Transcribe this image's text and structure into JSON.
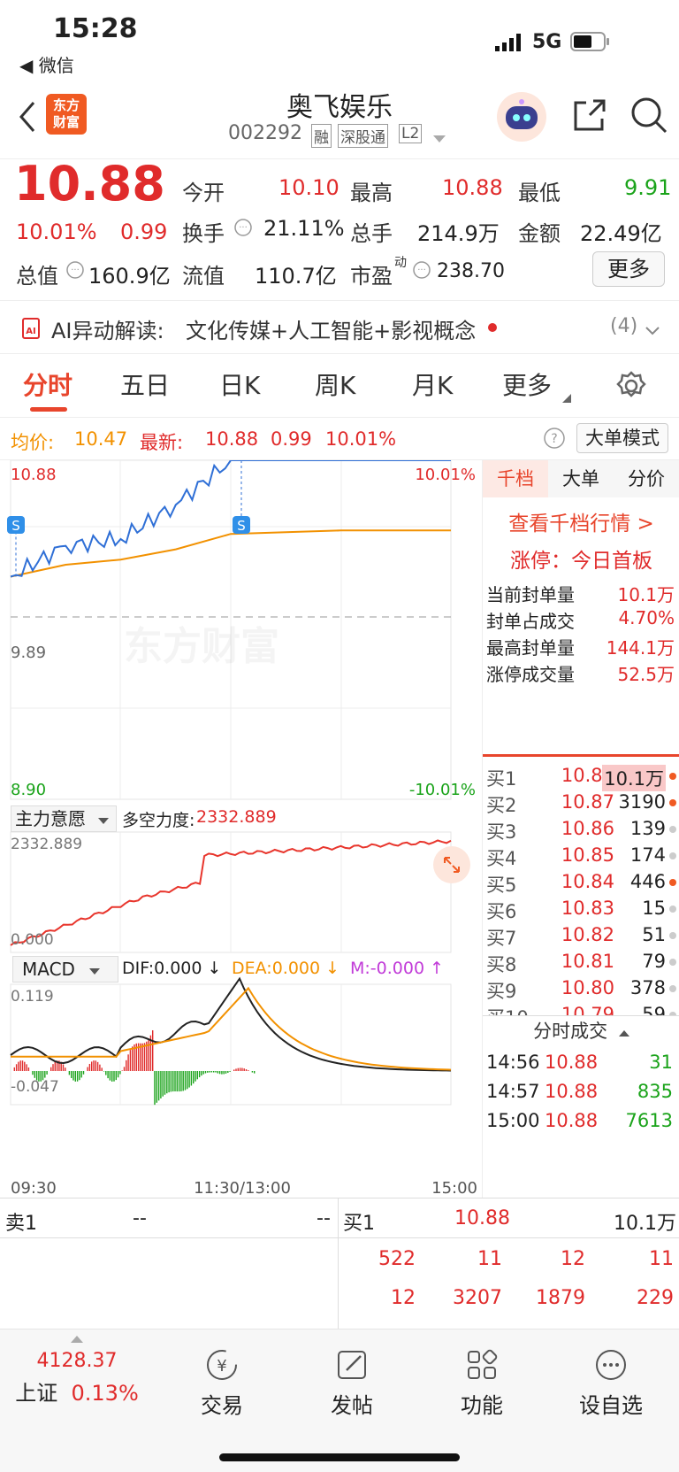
{
  "status_bar": {
    "time": "15:28",
    "back_app": "◀ 微信",
    "network": "5G"
  },
  "header": {
    "title": "奥飞娱乐",
    "code": "002292",
    "tags": [
      "融",
      "深股通",
      "L2"
    ],
    "logo_line1": "东方",
    "logo_line2": "财富"
  },
  "quote": {
    "price": "10.88",
    "change_pct": "10.01%",
    "change": "0.99",
    "fields": [
      {
        "label": "今开",
        "value": "10.10"
      },
      {
        "label": "最高",
        "value": "10.88"
      },
      {
        "label": "最低",
        "value": "9.91"
      },
      {
        "label": "换手",
        "value": "21.11%"
      },
      {
        "label": "总手",
        "value": "214.9万"
      },
      {
        "label": "金额",
        "value": "22.49亿"
      },
      {
        "label": "总值",
        "value": "160.9亿"
      },
      {
        "label": "流值",
        "value": "110.7亿"
      },
      {
        "label": "市盈",
        "value": "238.70"
      }
    ],
    "pe_sup": "动",
    "more_label": "更多"
  },
  "ai_bar": {
    "prefix": "AI异动解读:",
    "text": "文化传媒+人工智能+影视概念",
    "count": "(4)"
  },
  "tabs": [
    "分时",
    "五日",
    "日K",
    "周K",
    "月K",
    "更多"
  ],
  "info_bar": {
    "avg_label": "均价:",
    "avg": "10.47",
    "latest_label": "最新:",
    "latest": "10.88",
    "chg": "0.99",
    "pct": "10.01%",
    "mode_label": "大单模式"
  },
  "chart": {
    "y_top": "10.88",
    "y_mid": "9.89",
    "y_bot": "8.90",
    "pct_top": "10.01%",
    "pct_bot": "-10.01%",
    "watermark": "东方财富",
    "signal_label": "S",
    "sub1": {
      "selector": "主力意愿",
      "label": "多空力度:",
      "value": "2332.889",
      "y_top": "2332.889",
      "y_bot": "0.000"
    },
    "sub2": {
      "selector": "MACD",
      "dif": "DIF:0.000 ↓",
      "dea": "DEA:0.000 ↓",
      "m": "M:-0.000 ↑",
      "y_top": "0.119",
      "y_bot": "-0.047"
    },
    "x_labels": [
      "09:30",
      "11:30/13:00",
      "15:00"
    ]
  },
  "chart_data": {
    "type": "line",
    "title": "",
    "x": [
      "09:30",
      "10:00",
      "10:30",
      "11:00",
      "11:30/13:00",
      "13:30",
      "14:00",
      "14:30",
      "15:00"
    ],
    "series": [
      {
        "name": "最新",
        "values": [
          10.2,
          10.38,
          10.42,
          10.62,
          10.88,
          10.88,
          10.88,
          10.88,
          10.88
        ]
      },
      {
        "name": "均价",
        "values": [
          10.2,
          10.27,
          10.3,
          10.36,
          10.45,
          10.46,
          10.47,
          10.47,
          10.47
        ]
      }
    ],
    "ylim": [
      8.9,
      10.88
    ],
    "pre_close": 9.89,
    "grid": true
  },
  "side": {
    "tabs": [
      "千档",
      "大单",
      "分价"
    ],
    "link": "查看千档行情 >",
    "limit_title": "涨停：今日首板",
    "stats": [
      {
        "label": "当前封单量",
        "value": "10.1万"
      },
      {
        "label": "封单占成交",
        "value": "4.70%"
      },
      {
        "label": "最高封单量",
        "value": "144.1万"
      },
      {
        "label": "涨停成交量",
        "value": "52.5万"
      }
    ],
    "bids": [
      {
        "label": "买1",
        "price": "10.88",
        "vol": "10.1万"
      },
      {
        "label": "买2",
        "price": "10.87",
        "vol": "3190"
      },
      {
        "label": "买3",
        "price": "10.86",
        "vol": "139"
      },
      {
        "label": "买4",
        "price": "10.85",
        "vol": "174"
      },
      {
        "label": "买5",
        "price": "10.84",
        "vol": "446"
      },
      {
        "label": "买6",
        "price": "10.83",
        "vol": "15"
      },
      {
        "label": "买7",
        "price": "10.82",
        "vol": "51"
      },
      {
        "label": "买8",
        "price": "10.81",
        "vol": "79"
      },
      {
        "label": "买9",
        "price": "10.80",
        "vol": "378"
      },
      {
        "label": "买10",
        "price": "10.79",
        "vol": "59"
      }
    ],
    "trades_title": "分时成交",
    "trades": [
      {
        "time": "14:56",
        "price": "10.88",
        "vol": "31"
      },
      {
        "time": "14:57",
        "price": "10.88",
        "vol": "835"
      },
      {
        "time": "15:00",
        "price": "10.88",
        "vol": "7613"
      }
    ]
  },
  "pankou": {
    "sell1_label": "卖1",
    "sell1_price": "--",
    "sell1_vol": "--",
    "buy1_label": "买1",
    "buy1_price": "10.88",
    "buy1_vol": "10.1万",
    "row1": [
      "522",
      "11",
      "12",
      "11"
    ],
    "row2": [
      "12",
      "3207",
      "1879",
      "229"
    ]
  },
  "bottom": {
    "index_value": "4128.37",
    "index_name": "上证",
    "index_pct": "0.13%",
    "items": [
      {
        "label": "交易",
        "icon": "yen-icon"
      },
      {
        "label": "发帖",
        "icon": "edit-icon"
      },
      {
        "label": "功能",
        "icon": "grid-icon"
      },
      {
        "label": "设自选",
        "icon": "more-icon"
      }
    ]
  }
}
